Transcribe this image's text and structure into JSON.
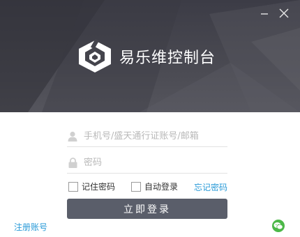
{
  "app": {
    "title": "易乐维控制台"
  },
  "window_controls": {
    "minimize_icon": "minimize-icon",
    "close_icon": "close-icon"
  },
  "form": {
    "username_placeholder": "手机号/盛天通行证账号/邮箱",
    "password_placeholder": "密码",
    "remember_label": "记住密码",
    "auto_login_label": "自动登录",
    "forgot_label": "忘记密码",
    "login_button": "立即登录"
  },
  "footer": {
    "register_label": "注册账号",
    "wechat_icon": "wechat-icon"
  },
  "colors": {
    "header_bg": "#44444c",
    "button_bg": "#5a5e6a",
    "link": "#2a9bd8",
    "wechat": "#4cb848"
  }
}
